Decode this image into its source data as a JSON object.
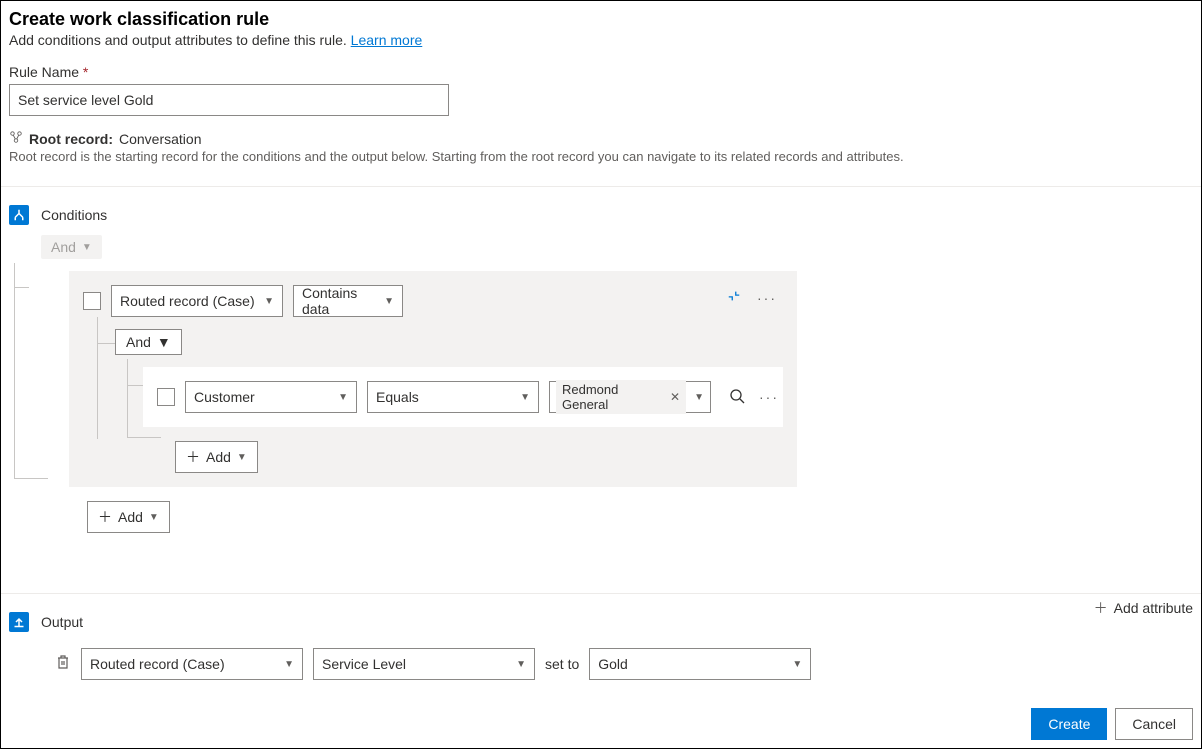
{
  "header": {
    "title": "Create work classification rule",
    "subtitle_prefix": "Add conditions and output attributes to define this rule. ",
    "learn_more": "Learn more"
  },
  "rule_name": {
    "label": "Rule Name",
    "value": "Set service level Gold"
  },
  "root_record": {
    "label": "Root record:",
    "value": "Conversation",
    "description": "Root record is the starting record for the conditions and the output below. Starting from the root record you can navigate to its related records and attributes."
  },
  "conditions": {
    "title": "Conditions",
    "top_operator": "And",
    "group": {
      "field": "Routed record (Case)",
      "operator": "Contains data",
      "sub_operator": "And",
      "inner": {
        "field": "Customer",
        "operator": "Equals",
        "value": "Redmond General"
      },
      "add_inner": "Add"
    },
    "add_outer": "Add"
  },
  "output": {
    "title": "Output",
    "add_attribute": "Add attribute",
    "row": {
      "entity": "Routed record (Case)",
      "attribute": "Service Level",
      "set_to": "set to",
      "value": "Gold"
    }
  },
  "footer": {
    "create": "Create",
    "cancel": "Cancel"
  }
}
